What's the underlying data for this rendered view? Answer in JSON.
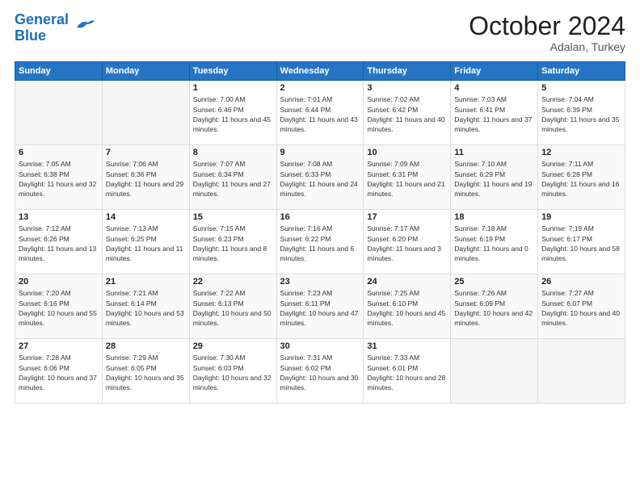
{
  "header": {
    "logo_line1": "General",
    "logo_line2": "Blue",
    "month": "October 2024",
    "location": "Adalan, Turkey"
  },
  "days_of_week": [
    "Sunday",
    "Monday",
    "Tuesday",
    "Wednesday",
    "Thursday",
    "Friday",
    "Saturday"
  ],
  "weeks": [
    [
      {
        "day": "",
        "info": ""
      },
      {
        "day": "",
        "info": ""
      },
      {
        "day": "1",
        "info": "Sunrise: 7:00 AM\nSunset: 6:46 PM\nDaylight: 11 hours and 45 minutes."
      },
      {
        "day": "2",
        "info": "Sunrise: 7:01 AM\nSunset: 6:44 PM\nDaylight: 11 hours and 43 minutes."
      },
      {
        "day": "3",
        "info": "Sunrise: 7:02 AM\nSunset: 6:42 PM\nDaylight: 11 hours and 40 minutes."
      },
      {
        "day": "4",
        "info": "Sunrise: 7:03 AM\nSunset: 6:41 PM\nDaylight: 11 hours and 37 minutes."
      },
      {
        "day": "5",
        "info": "Sunrise: 7:04 AM\nSunset: 6:39 PM\nDaylight: 11 hours and 35 minutes."
      }
    ],
    [
      {
        "day": "6",
        "info": "Sunrise: 7:05 AM\nSunset: 6:38 PM\nDaylight: 11 hours and 32 minutes."
      },
      {
        "day": "7",
        "info": "Sunrise: 7:06 AM\nSunset: 6:36 PM\nDaylight: 11 hours and 29 minutes."
      },
      {
        "day": "8",
        "info": "Sunrise: 7:07 AM\nSunset: 6:34 PM\nDaylight: 11 hours and 27 minutes."
      },
      {
        "day": "9",
        "info": "Sunrise: 7:08 AM\nSunset: 6:33 PM\nDaylight: 11 hours and 24 minutes."
      },
      {
        "day": "10",
        "info": "Sunrise: 7:09 AM\nSunset: 6:31 PM\nDaylight: 11 hours and 21 minutes."
      },
      {
        "day": "11",
        "info": "Sunrise: 7:10 AM\nSunset: 6:29 PM\nDaylight: 11 hours and 19 minutes."
      },
      {
        "day": "12",
        "info": "Sunrise: 7:11 AM\nSunset: 6:28 PM\nDaylight: 11 hours and 16 minutes."
      }
    ],
    [
      {
        "day": "13",
        "info": "Sunrise: 7:12 AM\nSunset: 6:26 PM\nDaylight: 11 hours and 13 minutes."
      },
      {
        "day": "14",
        "info": "Sunrise: 7:13 AM\nSunset: 6:25 PM\nDaylight: 11 hours and 11 minutes."
      },
      {
        "day": "15",
        "info": "Sunrise: 7:15 AM\nSunset: 6:23 PM\nDaylight: 11 hours and 8 minutes."
      },
      {
        "day": "16",
        "info": "Sunrise: 7:16 AM\nSunset: 6:22 PM\nDaylight: 11 hours and 6 minutes."
      },
      {
        "day": "17",
        "info": "Sunrise: 7:17 AM\nSunset: 6:20 PM\nDaylight: 11 hours and 3 minutes."
      },
      {
        "day": "18",
        "info": "Sunrise: 7:18 AM\nSunset: 6:19 PM\nDaylight: 11 hours and 0 minutes."
      },
      {
        "day": "19",
        "info": "Sunrise: 7:19 AM\nSunset: 6:17 PM\nDaylight: 10 hours and 58 minutes."
      }
    ],
    [
      {
        "day": "20",
        "info": "Sunrise: 7:20 AM\nSunset: 6:16 PM\nDaylight: 10 hours and 55 minutes."
      },
      {
        "day": "21",
        "info": "Sunrise: 7:21 AM\nSunset: 6:14 PM\nDaylight: 10 hours and 53 minutes."
      },
      {
        "day": "22",
        "info": "Sunrise: 7:22 AM\nSunset: 6:13 PM\nDaylight: 10 hours and 50 minutes."
      },
      {
        "day": "23",
        "info": "Sunrise: 7:23 AM\nSunset: 6:11 PM\nDaylight: 10 hours and 47 minutes."
      },
      {
        "day": "24",
        "info": "Sunrise: 7:25 AM\nSunset: 6:10 PM\nDaylight: 10 hours and 45 minutes."
      },
      {
        "day": "25",
        "info": "Sunrise: 7:26 AM\nSunset: 6:09 PM\nDaylight: 10 hours and 42 minutes."
      },
      {
        "day": "26",
        "info": "Sunrise: 7:27 AM\nSunset: 6:07 PM\nDaylight: 10 hours and 40 minutes."
      }
    ],
    [
      {
        "day": "27",
        "info": "Sunrise: 7:28 AM\nSunset: 6:06 PM\nDaylight: 10 hours and 37 minutes."
      },
      {
        "day": "28",
        "info": "Sunrise: 7:29 AM\nSunset: 6:05 PM\nDaylight: 10 hours and 35 minutes."
      },
      {
        "day": "29",
        "info": "Sunrise: 7:30 AM\nSunset: 6:03 PM\nDaylight: 10 hours and 32 minutes."
      },
      {
        "day": "30",
        "info": "Sunrise: 7:31 AM\nSunset: 6:02 PM\nDaylight: 10 hours and 30 minutes."
      },
      {
        "day": "31",
        "info": "Sunrise: 7:33 AM\nSunset: 6:01 PM\nDaylight: 10 hours and 28 minutes."
      },
      {
        "day": "",
        "info": ""
      },
      {
        "day": "",
        "info": ""
      }
    ]
  ]
}
